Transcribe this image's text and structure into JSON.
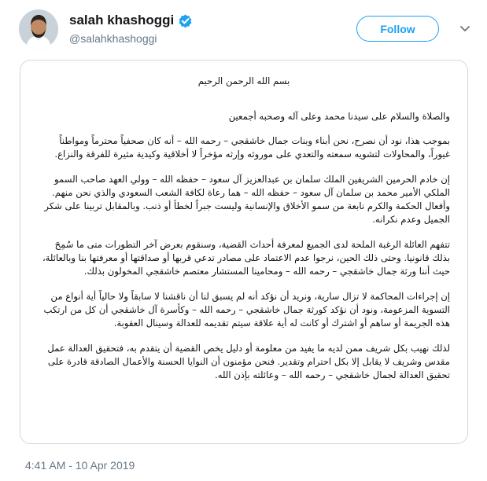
{
  "tweet": {
    "display_name": "salah khashoggi",
    "handle": "@salahkhashoggi",
    "verified": true,
    "follow_label": "Follow",
    "timestamp": "4:41 AM - 10 Apr 2019"
  },
  "statement": {
    "bismillah": "بسم الله الرحمن الرحيم",
    "salutation": "والصلاة والسلام على سيدنا محمد وعلى آله وصحبه أجمعين",
    "paragraphs": [
      "بموجب هذا، نود أن نصرح، نحن أبناء وبنات جمال خاشقجي – رحمه الله – أنه كان صحفياً محترماً ومواطناً غيوراً، والمحاولات لتشويه سمعته والتعدي على موروثه وإرثه مؤخراً لا أخلاقية وكيدية مثيرة للفرقة والنزاع.",
      "إن خادم الحرمين الشريفين الملك سلمان بن عبدالعزيز آل سعود – حفظه الله – وولي العهد صاحب السمو الملكي الأمير محمد بن سلمان آل سعود – حفظه الله – هما رعاة لكافة الشعب السعودي والذي نحن منهم. وأفعال الحكمة والكرم نابعة من سمو الأخلاق والإنسانية وليست جبراً لخطأ أو ذنب. وبالمقابل تربينا على شكر الجميل وعدم نكرانه.",
      "تتفهم العائلة الرغبة الملحة لدى الجميع لمعرفة أحداث القضية، وسنقوم بعرض آخر التطورات متى ما سُمِحَ بذلك قانونيا. وحتى ذلك الحين، نرجوا عدم الاعتماد على مصادر تدعي قربها أو صداقتها أو معرفتها بنا وبالعائلة، حيث أننا ورثة جمال خاشقجي – رحمه الله – ومحامينا المستشار معتصم خاشقجي المخولون بذلك.",
      "إن إجراءات المحاكمة لا تزال سارية، ونريد أن نؤكد أنه لم يسبق لنا أن ناقشنا لا سابقاً ولا حالياً أية أنواع من التسوية المزعومة، ونود أن نؤكد كورثة جمال خاشقجي – رحمه الله – وكأسرة آل خاشقجي أن كل من ارتكب هذه الجريمة أو ساهم أو اشترك أو كانت له أية علاقة سيتم تقديمه للعدالة وسينال العقوبة.",
      "لذلك نهيب بكل شريف ممن لديه ما يفيد من معلومة أو دليل يخص القضية أن يتقدم به، فتحقيق العدالة عمل مقدس وشريف لا يقابل إلا بكل احترام وتقدير. فنحن مؤمنون أن النوايا الحسنة والأعمال الصادقة قادرة على تحقيق العدالة لجمال خاشقجي – رحمه الله – وعائلته بإذن الله."
    ]
  },
  "icons": {
    "verified": "verified-badge-icon",
    "dropdown": "chevron-down-icon",
    "avatar": "profile-photo"
  },
  "colors": {
    "accent": "#1da1f2",
    "text": "#14171a",
    "muted": "#657786",
    "border": "#cfd9de"
  }
}
